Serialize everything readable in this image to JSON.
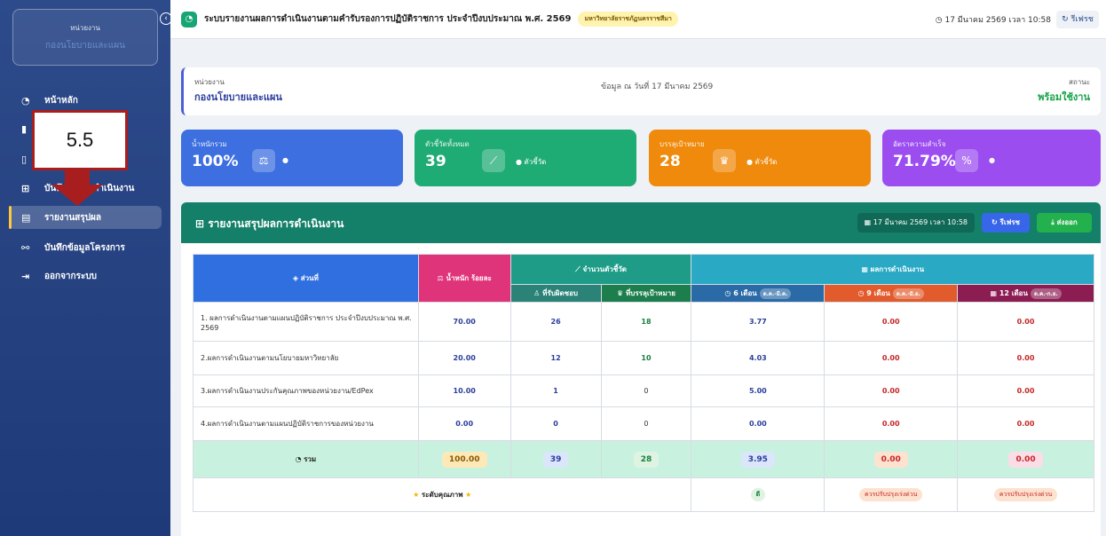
{
  "sidebar": {
    "unit_label": "หน่วยงาน",
    "unit_name": "กองนโยบายและแผน",
    "collapse_icon": "chevron-left-icon",
    "items": [
      {
        "label": "หน้าหลัก",
        "icon": "pie-chart-icon"
      },
      {
        "label": "",
        "icon": "clipboard-icon"
      },
      {
        "label": "",
        "icon": "file-icon"
      },
      {
        "label": "บันทึกผลการดำเนินงาน",
        "icon": "table-icon"
      },
      {
        "label": "รายงานสรุปผล",
        "icon": "file-report-icon"
      },
      {
        "label": "บันทึกข้อมูลโครงการ",
        "icon": "project-diagram-icon"
      },
      {
        "label": "ออกจากระบบ",
        "icon": "sign-out-icon"
      }
    ],
    "callout": "5.5"
  },
  "topbar": {
    "title": "ระบบรายงานผลการดำเนินงานตามคำรับรองการปฏิบัติราชการ ประจำปีงบประมาณ พ.ศ. 2569",
    "badge": "มหาวิทยาลัยราชภัฏนครราชสีมา",
    "time": "17 มีนาคม 2569 เวลา 10:58",
    "refresh": "รีเฟรช"
  },
  "info": {
    "unit_label": "หน่วยงาน",
    "unit_name": "กองนโยบายและแผน",
    "date_text": "ข้อมูล ณ วันที่ 17 มีนาคม 2569",
    "status_label": "สถานะ",
    "status_value": "พร้อมใช้งาน"
  },
  "cards": [
    {
      "label": "น้ำหนักรวม",
      "value": "100%",
      "sub": "",
      "color": "#3d6fe0"
    },
    {
      "label": "ตัวชี้วัดทั้งหมด",
      "value": "39",
      "sub": "ตัวชี้วัด",
      "color": "#1fab74"
    },
    {
      "label": "บรรลุเป้าหมาย",
      "value": "28",
      "sub": "ตัวชี้วัด",
      "color": "#f08a0c"
    },
    {
      "label": "อัตราความสำเร็จ",
      "value": "71.79%",
      "sub": "",
      "color": "#9b4df0"
    }
  ],
  "panel": {
    "title": "รายงานสรุปผลการดำเนินงาน",
    "date": "17 มีนาคม 2569 เวลา 10:58",
    "refresh": "รีเฟรช",
    "export": "ส่งออก"
  },
  "table": {
    "h_section": "ส่วนที่",
    "h_weight": "น้ำหนัก ร้อยละ",
    "h_kpi": "จำนวนตัวชี้วัด",
    "h_responsible": "ที่รับผิดชอบ",
    "h_achieved": "ที่บรรลุเป้าหมาย",
    "h_result": "ผลการดำเนินงาน",
    "h_6": "6 เดือน",
    "h_6_tag": "ต.ค.-มี.ค.",
    "h_9": "9 เดือน",
    "h_9_tag": "ต.ค.-มิ.ย.",
    "h_12": "12 เดือน",
    "h_12_tag": "ต.ค.-ก.ย.",
    "rows": [
      {
        "name": "1. ผลการดำเนินงานตามแผนปฏิบัติราชการ ประจำปีงบประมาณ พ.ศ. 2569",
        "weight": "70.00",
        "responsible": "26",
        "achieved": "18",
        "m6": "3.77",
        "m9": "0.00",
        "m12": "0.00"
      },
      {
        "name": "2.ผลการดำเนินงานตามนโยบายมหาวิทยาลัย",
        "weight": "20.00",
        "responsible": "12",
        "achieved": "10",
        "m6": "4.03",
        "m9": "0.00",
        "m12": "0.00"
      },
      {
        "name": "3.ผลการดำเนินงานประกันคุณภาพของหน่วยงาน/EdPex",
        "weight": "10.00",
        "responsible": "1",
        "achieved": "0",
        "m6": "5.00",
        "m9": "0.00",
        "m12": "0.00"
      },
      {
        "name": "4.ผลการดำเนินงานตามแผนปฏิบัติราชการของหน่วยงาน",
        "weight": "0.00",
        "responsible": "0",
        "achieved": "0",
        "m6": "0.00",
        "m9": "0.00",
        "m12": "0.00"
      }
    ],
    "total": {
      "label": "รวม",
      "weight": "100.00",
      "responsible": "39",
      "achieved": "28",
      "m6": "3.95",
      "m9": "0.00",
      "m12": "0.00"
    },
    "quality": {
      "label": "ระดับคุณภาพ",
      "m6": "ดี",
      "m9": "ควรปรับปรุงเร่งด่วน",
      "m12": "ควรปรับปรุงเร่งด่วน"
    }
  }
}
